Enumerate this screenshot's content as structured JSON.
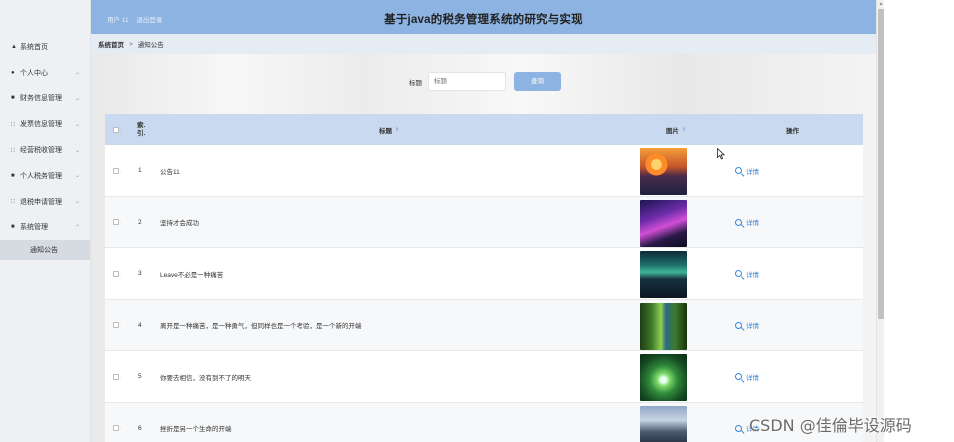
{
  "sidebar": {
    "items": [
      {
        "label": "系统首页",
        "icon": "home-icon",
        "glyph": "▲",
        "expandable": false
      },
      {
        "label": "个人中心",
        "icon": "user-icon",
        "glyph": "●",
        "expandable": true
      },
      {
        "label": "财务信息管理",
        "icon": "chat-icon",
        "glyph": "■",
        "expandable": true
      },
      {
        "label": "发票信息管理",
        "icon": "grid-icon",
        "glyph": "∷",
        "expandable": true
      },
      {
        "label": "经营税收管理",
        "icon": "grid-icon",
        "glyph": "∷",
        "expandable": true
      },
      {
        "label": "个人税务管理",
        "icon": "chat-icon",
        "glyph": "■",
        "expandable": true
      },
      {
        "label": "退税申请管理",
        "icon": "grid-icon",
        "glyph": "∷",
        "expandable": true
      },
      {
        "label": "系统管理",
        "icon": "briefcase-icon",
        "glyph": "■",
        "expandable": true,
        "expanded": true
      }
    ],
    "sub_item": "通知公告",
    "chevron_down": "⌄",
    "chevron_up": "⌃"
  },
  "header": {
    "user": "用户 11",
    "logout": "退出登录",
    "title": "基于java的税务管理系统的研究与实现",
    "color": "#8db3e2"
  },
  "breadcrumb": {
    "home": "系统首页",
    "separator": ">",
    "current": "通知公告"
  },
  "search": {
    "label": "标题",
    "placeholder": "标题",
    "button": "查询"
  },
  "table": {
    "columns": {
      "index": "索引",
      "title": "标题",
      "image": "图片",
      "action": "操作"
    },
    "index_header_lines": [
      "索.",
      "引."
    ],
    "sort_glyph": "⇕",
    "action_label": "详情",
    "rows": [
      {
        "index": "1",
        "title": "公告11",
        "image": "sunset-lake"
      },
      {
        "index": "2",
        "title": "坚持才会成功",
        "image": "purple-night-sky"
      },
      {
        "index": "3",
        "title": "Leave不必是一种痛苦",
        "image": "aurora-cabin"
      },
      {
        "index": "4",
        "title": "离开是一种痛苦，是一种勇气，但同样也是一个考验，是一个新的开端",
        "image": "forest-river"
      },
      {
        "index": "5",
        "title": "你要去相信，没有到不了的明天",
        "image": "tree-canopy"
      },
      {
        "index": "6",
        "title": "挫折是另一个生命的开端",
        "image": "mountain-clouds"
      }
    ]
  },
  "watermark": "CSDN @佳倫毕设源码"
}
